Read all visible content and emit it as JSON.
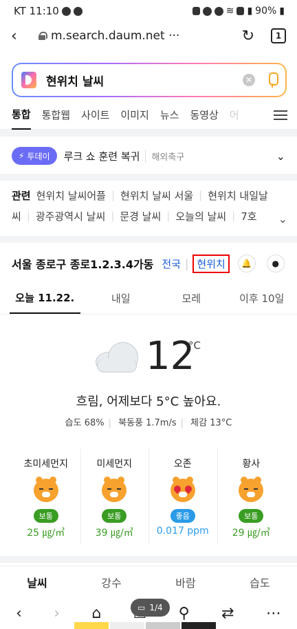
{
  "status_bar": {
    "carrier_time": "KT 11:10",
    "battery": "90%"
  },
  "browser": {
    "url": "m.search.daum.net ···",
    "tab_count": "1"
  },
  "search": {
    "query": "현위치 날씨"
  },
  "category_tabs": [
    "통합",
    "통합웹",
    "사이트",
    "이미지",
    "뉴스",
    "동영상",
    "어"
  ],
  "today": {
    "badge": "투데이",
    "title": "루크 쇼 훈련 복귀",
    "sub": "해외축구"
  },
  "related": {
    "label": "관련",
    "row1": [
      "현위치 날씨어플",
      "현위치 날씨 서울",
      "현위치 내일날"
    ],
    "row2": [
      "씨",
      "광주광역시 날씨",
      "문경 날씨",
      "오늘의 날씨",
      "7호"
    ]
  },
  "location": {
    "name": "서울 종로구 종로1.2.3.4가동",
    "national": "전국",
    "current": "현위치"
  },
  "day_tabs": [
    "오늘 11.22.",
    "내일",
    "모레",
    "이후 10일"
  ],
  "weather": {
    "temp": "12",
    "unit": "°C",
    "description": "흐림, 어제보다 5°C 높아요.",
    "humidity": "습도 68%",
    "wind": "북동풍 1.7m/s",
    "feels": "체감 13°C"
  },
  "air": [
    {
      "name": "초미세먼지",
      "status": "보통",
      "value": "25 ㎍/㎥",
      "color": "#3a9d23",
      "face": "normal"
    },
    {
      "name": "미세먼지",
      "status": "보통",
      "value": "39 ㎍/㎥",
      "color": "#3a9d23",
      "face": "normal"
    },
    {
      "name": "오존",
      "status": "좋음",
      "value": "0.017 ppm",
      "color": "#2b9be8",
      "face": "love"
    },
    {
      "name": "황사",
      "status": "보통",
      "value": "29 ㎍/㎥",
      "color": "#3a9d23",
      "face": "normal"
    }
  ],
  "bottom_tabs": [
    "날씨",
    "강수",
    "바람",
    "습도"
  ],
  "pager": "1/4"
}
